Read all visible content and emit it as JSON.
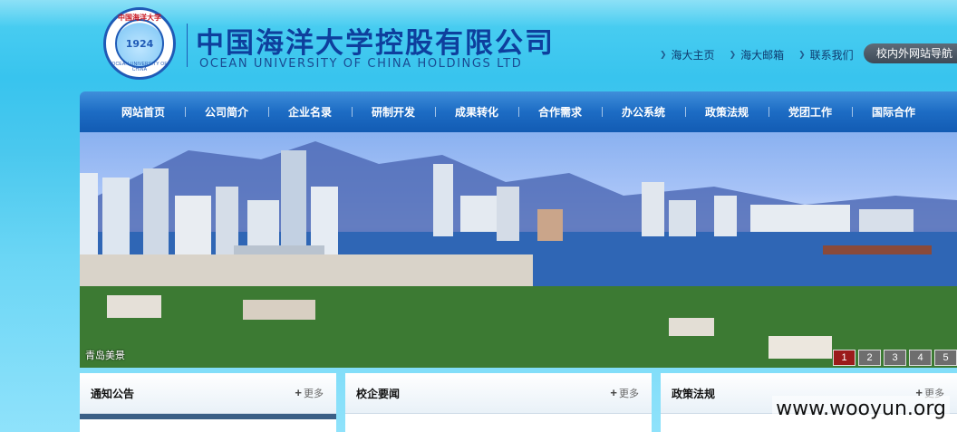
{
  "header": {
    "logo": {
      "ring_top": "中国海洋大学",
      "year": "1924",
      "ring_bottom": "OCEAN UNIVERSITY OF CHINA"
    },
    "title_cn": "中国海洋大学控股有限公司",
    "title_en": "OCEAN UNIVERSITY OF CHINA HOLDINGS LTD",
    "top_links": [
      "海大主页",
      "海大邮箱",
      "联系我们"
    ],
    "nav_button": "校内外网站导航"
  },
  "nav": {
    "items": [
      "网站首页",
      "公司简介",
      "企业名录",
      "研制开发",
      "成果转化",
      "合作需求",
      "办公系统",
      "政策法规",
      "党团工作",
      "国际合作"
    ]
  },
  "banner": {
    "caption": "青岛美景",
    "pages": [
      "1",
      "2",
      "3",
      "4",
      "5"
    ],
    "active_page": 1
  },
  "panels": [
    {
      "title": "通知公告",
      "more": "更多"
    },
    {
      "title": "校企要闻",
      "more": "更多"
    },
    {
      "title": "政策法规",
      "more": "更多"
    }
  ],
  "watermark": "www.wooyun.org",
  "colors": {
    "nav_blue": "#1d6cc4",
    "title_blue": "#0e3f9d",
    "active_page": "#9b1b1b"
  }
}
